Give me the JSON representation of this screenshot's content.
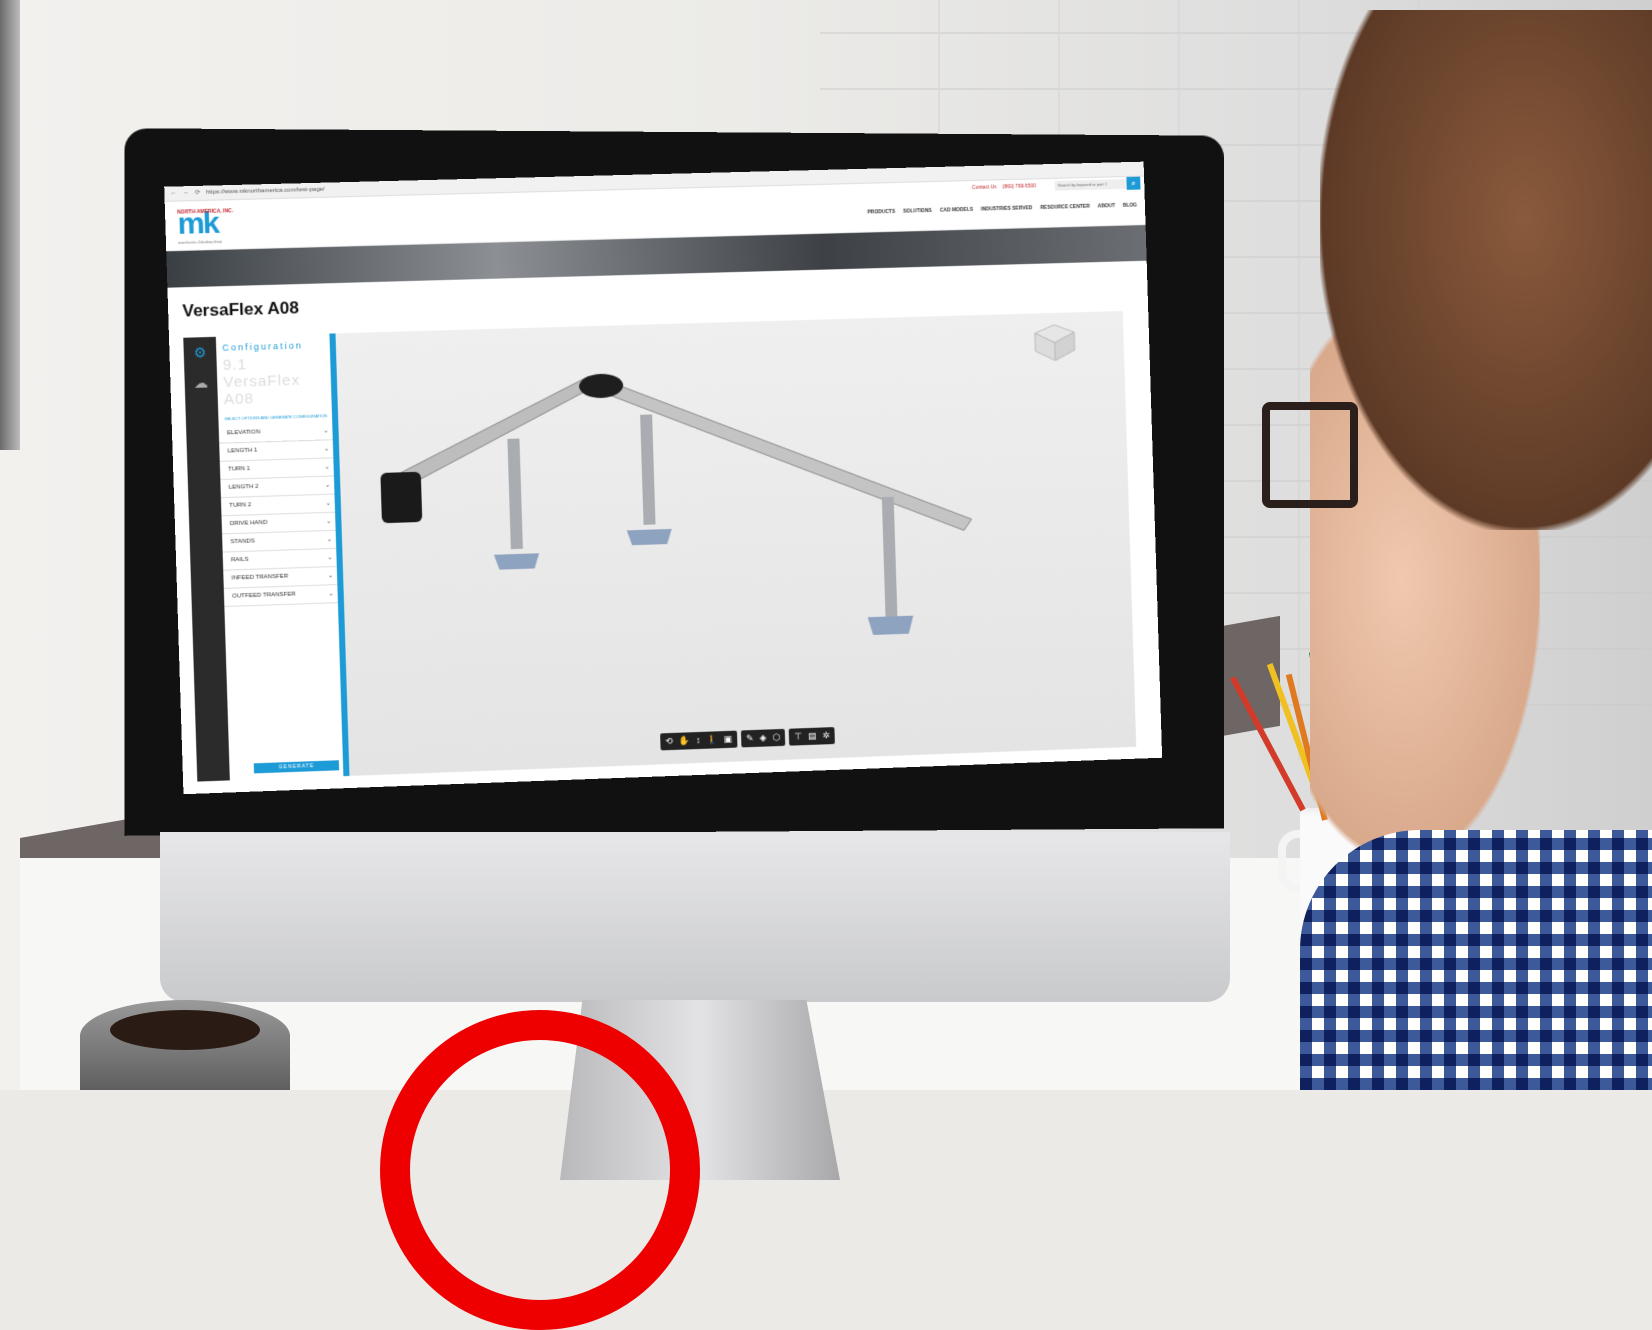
{
  "browser": {
    "url": "https://www.mknorthamerica.com/test-page/"
  },
  "site": {
    "logo": {
      "top": "NORTH AMERICA, INC.",
      "main": "mk",
      "tagline": "www.the-mk-c-Subsidiary-Group"
    },
    "contact_label": "Contact Us",
    "phone": "(860) 769-5500",
    "search_placeholder": "Search by keyword or part #",
    "nav": [
      "PRODUCTS",
      "SOLUTIONS",
      "CAD MODELS",
      "INDUSTRIES SERVED",
      "RESOURCE CENTER",
      "ABOUT",
      "BLOG"
    ]
  },
  "page_title": "VersaFlex A08",
  "configurator": {
    "heading": "Configuration",
    "product_lines": [
      "9.1",
      "VersaFlex",
      "A08"
    ],
    "hint": "SELECT OPTIONS AND GENERATE CONFIGURATION",
    "side_tab": "CONFIGURE",
    "options": [
      "ELEVATION",
      "LENGTH 1",
      "TURN 1",
      "LENGTH 2",
      "TURN 2",
      "DRIVE HAND",
      "STANDS",
      "RAILS",
      "INFEED TRANSFER",
      "OUTFEED TRANSFER"
    ],
    "generate_label": "GENERATE"
  },
  "toolbar_groups": [
    [
      "rotate-icon",
      "pan-icon",
      "zoom-icon",
      "walk-icon",
      "camera-icon"
    ],
    [
      "measure-icon",
      "explode-icon",
      "parts-icon"
    ],
    [
      "tree-icon",
      "save-icon",
      "settings-icon"
    ]
  ]
}
